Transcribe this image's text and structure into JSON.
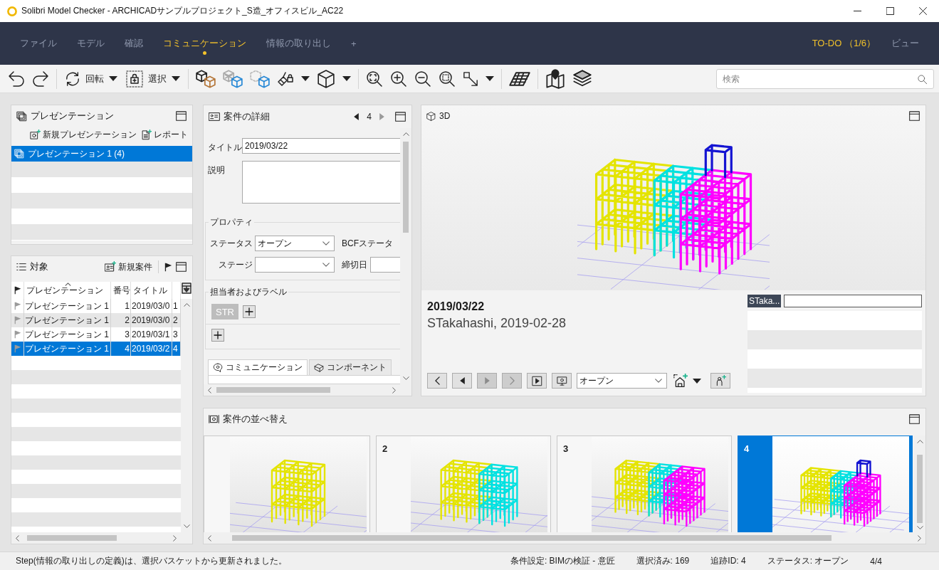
{
  "window": {
    "title": "Solibri Model Checker - ARCHICADサンプルプロジェクト_S造_オフィスビル_AC22"
  },
  "menu": {
    "tabs": [
      {
        "label": "ファイル",
        "selected": false
      },
      {
        "label": "モデル",
        "selected": false
      },
      {
        "label": "確認",
        "selected": false
      },
      {
        "label": "コミュニケーション",
        "selected": true
      },
      {
        "label": "情報の取り出し",
        "selected": false
      }
    ],
    "add_tab": "+",
    "right_tabs": [
      {
        "label": "TO-DO （1/6）",
        "highlighted": true
      },
      {
        "label": "ビュー",
        "highlighted": false
      }
    ]
  },
  "toolbar": {
    "rotate_label": "回転",
    "select_label": "選択",
    "search": {
      "placeholder": "検索"
    }
  },
  "presentations_panel": {
    "title": "プレゼンテーション",
    "new_button": "新規プレゼンテーション",
    "report_button": "レポート",
    "items": [
      {
        "label": "プレゼンテーション 1 (4)",
        "selected": true
      }
    ]
  },
  "issues_panel": {
    "title": "対象",
    "new_button": "新規案件",
    "columns": [
      {
        "label": "プレゼンテーション",
        "sorted": true
      },
      {
        "label": "番号",
        "sorted": false
      },
      {
        "label": "タイトル",
        "sorted": false
      }
    ],
    "rows": [
      {
        "presentation": "プレゼンテーション 1",
        "number": "1",
        "title": "2019/03/0",
        "column_5": "1",
        "selected": false
      },
      {
        "presentation": "プレゼンテーション 1",
        "number": "2",
        "title": "2019/03/0",
        "column_5": "2",
        "selected": false
      },
      {
        "presentation": "プレゼンテーション 1",
        "number": "3",
        "title": "2019/03/1",
        "column_5": "3",
        "selected": false
      },
      {
        "presentation": "プレゼンテーション 1",
        "number": "4",
        "title": "2019/03/2",
        "column_5": "4",
        "selected": true
      }
    ]
  },
  "details_panel": {
    "title": "案件の詳細",
    "counter": "4",
    "prev_disabled": false,
    "next_disabled": true,
    "title_label": "タイトル",
    "title_value": "2019/03/22",
    "description_label": "説明",
    "properties": {
      "legend": "プロパティ",
      "status_label": "ステータス",
      "status_value": "オープン",
      "bcf_status_label": "BCFステータ",
      "stage_label": "ステージ",
      "deadline_label": "締切日"
    },
    "assignees": {
      "legend": "担当者およびラベル",
      "chips": [
        "STR"
      ]
    },
    "tabs": [
      {
        "label": "コミュニケーション",
        "selected": true
      },
      {
        "label": "コンポーネント",
        "selected": false
      }
    ]
  },
  "view_3d": {
    "title": "3D",
    "issue_title": "2019/03/22",
    "issue_meta": "STakahashi, 2019-02-28",
    "nav_buttons": [
      {
        "kind": "back",
        "disabled": false
      },
      {
        "kind": "previous",
        "disabled": false
      },
      {
        "kind": "next",
        "disabled": true
      },
      {
        "kind": "forward",
        "disabled": true
      }
    ],
    "status_value": "オープン",
    "comment_author": "STaka..."
  },
  "arrange_panel": {
    "title": "案件の並べ替え",
    "cards": [
      {
        "selected": false
      },
      {
        "number": "2",
        "selected": false
      },
      {
        "number": "3",
        "selected": false
      },
      {
        "number": "4",
        "selected": true
      }
    ]
  },
  "status_bar": {
    "message": "Step(情報の取り出しの定義)は、選択バスケットから更新されました。",
    "items": [
      "条件設定: BIMの検証 - 意匠",
      "選択済み: 169",
      "追跡ID: 4",
      "ステータス: オープン",
      "4/4"
    ]
  }
}
